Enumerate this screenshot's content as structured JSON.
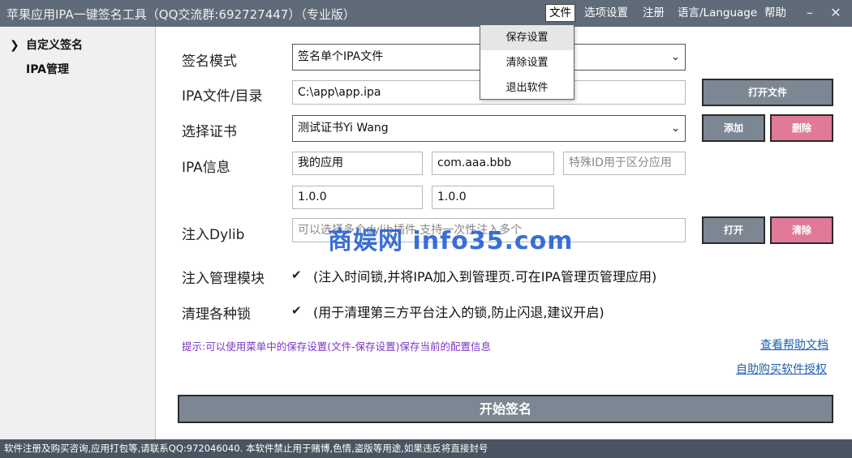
{
  "window": {
    "title": "苹果应用IPA一键签名工具（QQ交流群:692727447）（专业版）",
    "minimize_glyph": "–",
    "close_glyph": "✕"
  },
  "menu": {
    "items": [
      "文件",
      "选项设置",
      "注册",
      "语言/Language",
      "帮助"
    ],
    "active": "文件"
  },
  "file_menu": {
    "items": [
      "保存设置",
      "清除设置",
      "退出软件"
    ],
    "hovered": "保存设置"
  },
  "sidebar": {
    "items": [
      {
        "label": "自定义签名",
        "selected": true
      },
      {
        "label": "IPA管理",
        "selected": false
      }
    ],
    "arrow_icon": "chevron-right-icon"
  },
  "form": {
    "sign_mode": {
      "label": "签名模式",
      "value": "签名单个IPA文件"
    },
    "ipa_path": {
      "label": "IPA文件/目录",
      "value": "C:\\app\\app.ipa",
      "button": "打开文件"
    },
    "certificate": {
      "label": "选择证书",
      "value": "测试证书Yi Wang",
      "add_button": "添加",
      "delete_button": "删除"
    },
    "ipa_info": {
      "label": "IPA信息",
      "app_name": "我的应用",
      "bundle_id": "com.aaa.bbb",
      "special_id_placeholder": "特殊ID用于区分应用",
      "version": "1.0.0",
      "build": "1.0.0"
    },
    "dylib": {
      "label": "注入Dylib",
      "placeholder": "可以选择多个dylib插件,支持一次性注入多个",
      "open_button": "打开",
      "clear_button": "清除"
    },
    "inject_manager": {
      "label": "注入管理模块",
      "checked": true,
      "description": "(注入时间锁,并将IPA加入到管理页.可在IPA管理页管理应用)"
    },
    "clean_locks": {
      "label": "清理各种锁",
      "checked": true,
      "description": "(用于清理第三方平台注入的锁,防止闪退,建议开启)"
    }
  },
  "hint": "提示:可以使用菜单中的保存设置(文件-保存设置)保存当前的配置信息",
  "links": {
    "help": "查看帮助文档",
    "buy": "自助购买软件授权"
  },
  "start_button": "开始签名",
  "watermark": "商娱网 info35.com",
  "status": "软件注册及购买咨询,应用打包等,请联系QQ:972046040.  本软件禁止用于赌博,色情,盗版等用途,如果违反将直接封号",
  "colors": {
    "titlebar": "#5f6b78",
    "button_gray": "#7c8793",
    "button_pink": "#e07a98",
    "hint": "#7b35c8",
    "link": "#1f5fb3",
    "statusbar": "#4a5561"
  }
}
